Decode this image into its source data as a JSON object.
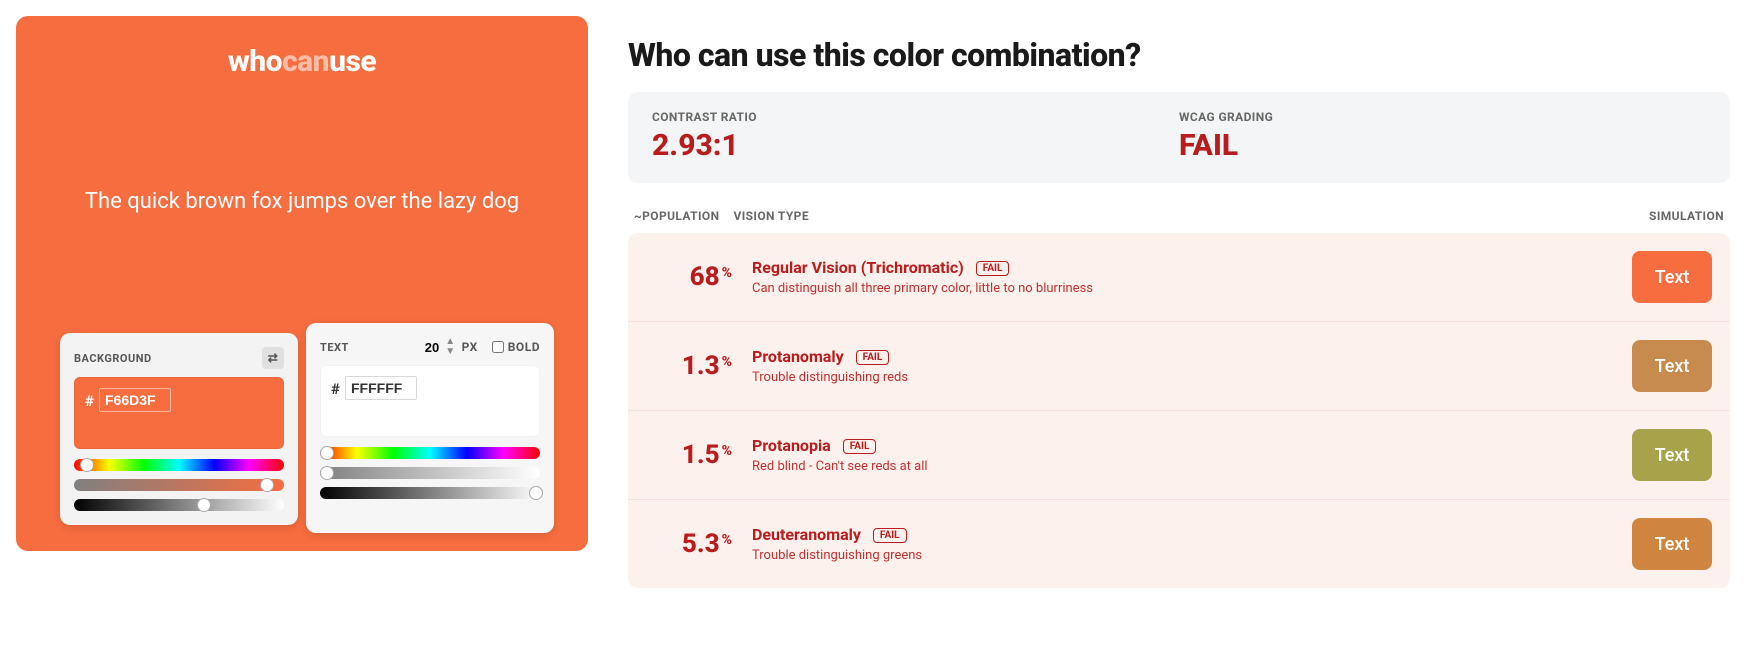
{
  "preview": {
    "bg_color": "F66D3F",
    "text_color": "FFFFFF",
    "logo_who": "who",
    "logo_can": "can",
    "logo_use": "use",
    "sample": "The quick brown fox jumps over the lazy dog"
  },
  "bg_picker": {
    "label": "BACKGROUND",
    "value": "F66D3F",
    "hue_thumb_pct": 6,
    "sat_thumb_pct": 92,
    "light_thumb_pct": 62
  },
  "text_picker": {
    "label": "TEXT",
    "value": "FFFFFF",
    "font_size": "20",
    "px": "PX",
    "bold": "BOLD",
    "hue_thumb_pct": 3,
    "sat_thumb_pct": 3,
    "light_thumb_pct": 98
  },
  "heading": "Who can use this color combination?",
  "metrics": {
    "ratio_label": "CONTRAST RATIO",
    "ratio_value": "2.93:1",
    "grade_label": "WCAG GRADING",
    "grade_value": "FAIL",
    "grade_color": "#b91c1c"
  },
  "list_head": {
    "pop": "~POPULATION",
    "vision": "VISION TYPE",
    "sim": "SIMULATION"
  },
  "rows": [
    {
      "pop": "68",
      "name": "Regular Vision (Trichromatic)",
      "badge": "FAIL",
      "desc": "Can distinguish all three primary color, little to no blurriness",
      "sim_bg": "#f66d3f",
      "sim_text": "Text"
    },
    {
      "pop": "1.3",
      "name": "Protanomaly",
      "badge": "FAIL",
      "desc": "Trouble distinguishing reds",
      "sim_bg": "#c78b4f",
      "sim_text": "Text"
    },
    {
      "pop": "1.5",
      "name": "Protanopia",
      "badge": "FAIL",
      "desc": "Red blind - Can't see reds at all",
      "sim_bg": "#a8a24a",
      "sim_text": "Text"
    },
    {
      "pop": "5.3",
      "name": "Deuteranomaly",
      "badge": "FAIL",
      "desc": "Trouble distinguishing greens",
      "sim_bg": "#cf853f",
      "sim_text": "Text"
    }
  ]
}
